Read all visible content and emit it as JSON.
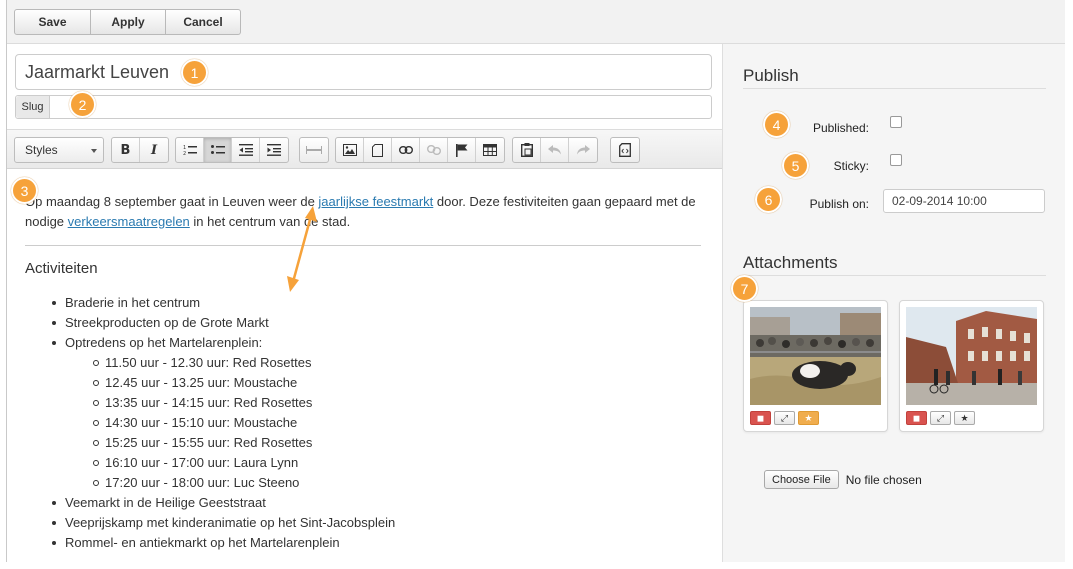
{
  "toolbar": {
    "save": "Save",
    "apply": "Apply",
    "cancel": "Cancel"
  },
  "editor": {
    "title_value": "Jaarmarkt Leuven",
    "slug_label": "Slug",
    "slug_value": "",
    "styles_label": "Styles",
    "intro_part1": "Op maandag 8 september gaat in Leuven weer de ",
    "intro_link1": "jaarlijkse feestmarkt",
    "intro_part2": " door. Deze festiviteiten gaan gepaard met de nodige ",
    "intro_link2": "verkeersmaatregelen",
    "intro_part3": " in het centrum van de stad.",
    "heading": "Activiteiten",
    "list": [
      {
        "text": "Braderie in het centrum",
        "level": 1
      },
      {
        "text": "Streekproducten op de Grote Markt",
        "level": 1
      },
      {
        "text": "Optredens op het Martelarenplein:",
        "level": 1
      },
      {
        "text": "11.50 uur - 12.30 uur: Red Rosettes",
        "level": 2
      },
      {
        "text": "12.45 uur - 13.25 uur: Moustache",
        "level": 2
      },
      {
        "text": "13:35 uur - 14:15 uur: Red Rosettes",
        "level": 2
      },
      {
        "text": "14:30 uur - 15:10 uur: Moustache",
        "level": 2
      },
      {
        "text": "15:25 uur - 15:55 uur: Red Rosettes",
        "level": 2
      },
      {
        "text": "16:10 uur - 17:00 uur: Laura Lynn",
        "level": 2
      },
      {
        "text": "17:20 uur - 18:00 uur: Luc Steeno",
        "level": 2
      },
      {
        "text": "Veemarkt in de Heilige Geeststraat",
        "level": 1
      },
      {
        "text": "Veeprijskamp met kinderanimatie op het Sint-Jacobsplein",
        "level": 1
      },
      {
        "text": "Rommel- en antiekmarkt op het Martelarenplein",
        "level": 1
      }
    ]
  },
  "sidebar": {
    "publish_title": "Publish",
    "published_label": "Published:",
    "sticky_label": "Sticky:",
    "publish_on_label": "Publish on:",
    "publish_on_value": "02-09-2014 10:00",
    "attachments_title": "Attachments",
    "choose_file": "Choose File",
    "no_file": "No file chosen"
  },
  "callouts": [
    "1",
    "2",
    "3",
    "4",
    "5",
    "6",
    "7"
  ],
  "colors": {
    "badge": "#f6a23a",
    "link": "#2a7ab0",
    "delete": "#d9534f",
    "featured": "#f0ad4e"
  }
}
